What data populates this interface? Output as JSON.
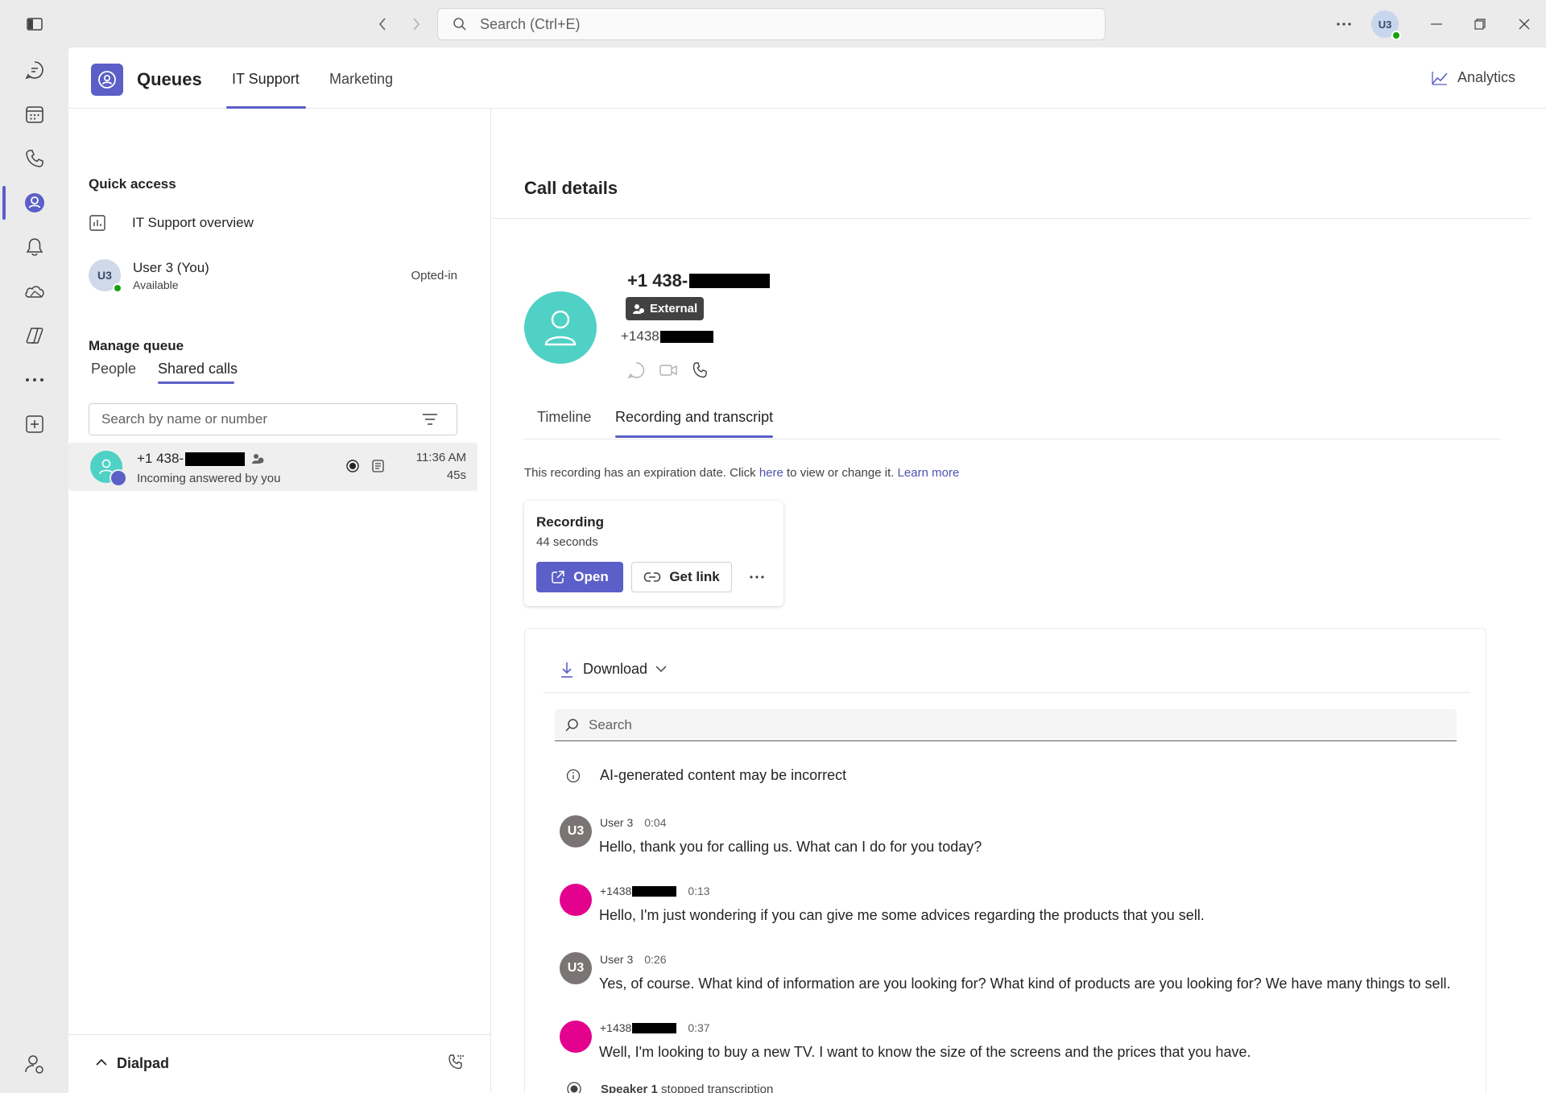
{
  "titlebar": {
    "search_placeholder": "Search (Ctrl+E)",
    "avatar_initials": "U3"
  },
  "app": {
    "title": "Queues",
    "tabs": [
      {
        "label": "IT Support"
      },
      {
        "label": "Marketing"
      }
    ],
    "analytics_label": "Analytics"
  },
  "left": {
    "quick_access_title": "Quick access",
    "overview_label": "IT Support overview",
    "user": {
      "initials": "U3",
      "name": "User 3 (You)",
      "status": "Available",
      "opt_status": "Opted-in"
    },
    "manage_queue_title": "Manage queue",
    "subtabs": [
      {
        "label": "People"
      },
      {
        "label": "Shared calls"
      }
    ],
    "search_placeholder": "Search by name or number",
    "call": {
      "number": "+1 438-",
      "subtitle": "Incoming answered by you",
      "time": "11:36 AM",
      "duration": "45s"
    },
    "dialpad_label": "Dialpad"
  },
  "details": {
    "title": "Call details",
    "phone_display": "+1 438-",
    "badge": "External",
    "phone_secondary": "+1438",
    "tabs": [
      {
        "label": "Timeline"
      },
      {
        "label": "Recording and transcript"
      }
    ],
    "notice_pre": "This recording has an expiration date. Click ",
    "notice_link": "here",
    "notice_post": " to view or change it. ",
    "notice_learn": "Learn more",
    "recording": {
      "title": "Recording",
      "duration": "44 seconds",
      "open_label": "Open",
      "link_label": "Get link"
    },
    "download_label": "Download",
    "transcript_search_placeholder": "Search",
    "ai_notice": "AI-generated content may be incorrect",
    "messages": [
      {
        "speaker": "User 3",
        "initials": "U3",
        "time": "0:04",
        "text": "Hello, thank you for calling us. What can I do for you today?"
      },
      {
        "speaker": "+1438",
        "initials": "",
        "time": "0:13",
        "text": "Hello, I'm just wondering if you can give me some advices regarding the products that you sell."
      },
      {
        "speaker": "User 3",
        "initials": "U3",
        "time": "0:26",
        "text": "Yes, of course. What kind of information are you looking for? What kind of products are you looking for? We have many things to sell."
      },
      {
        "speaker": "+1438",
        "initials": "",
        "time": "0:37",
        "text": "Well, I'm looking to buy a new TV. I want to know the size of the screens and the prices that you have."
      }
    ],
    "stopped": {
      "speaker": "Speaker 1",
      "text": " stopped transcription"
    }
  },
  "colors": {
    "accent": "#5b5fc7",
    "teal_avatar": "#4fd1c5",
    "pink_avatar": "#e3008c",
    "user_avatar": "#7a7574"
  }
}
